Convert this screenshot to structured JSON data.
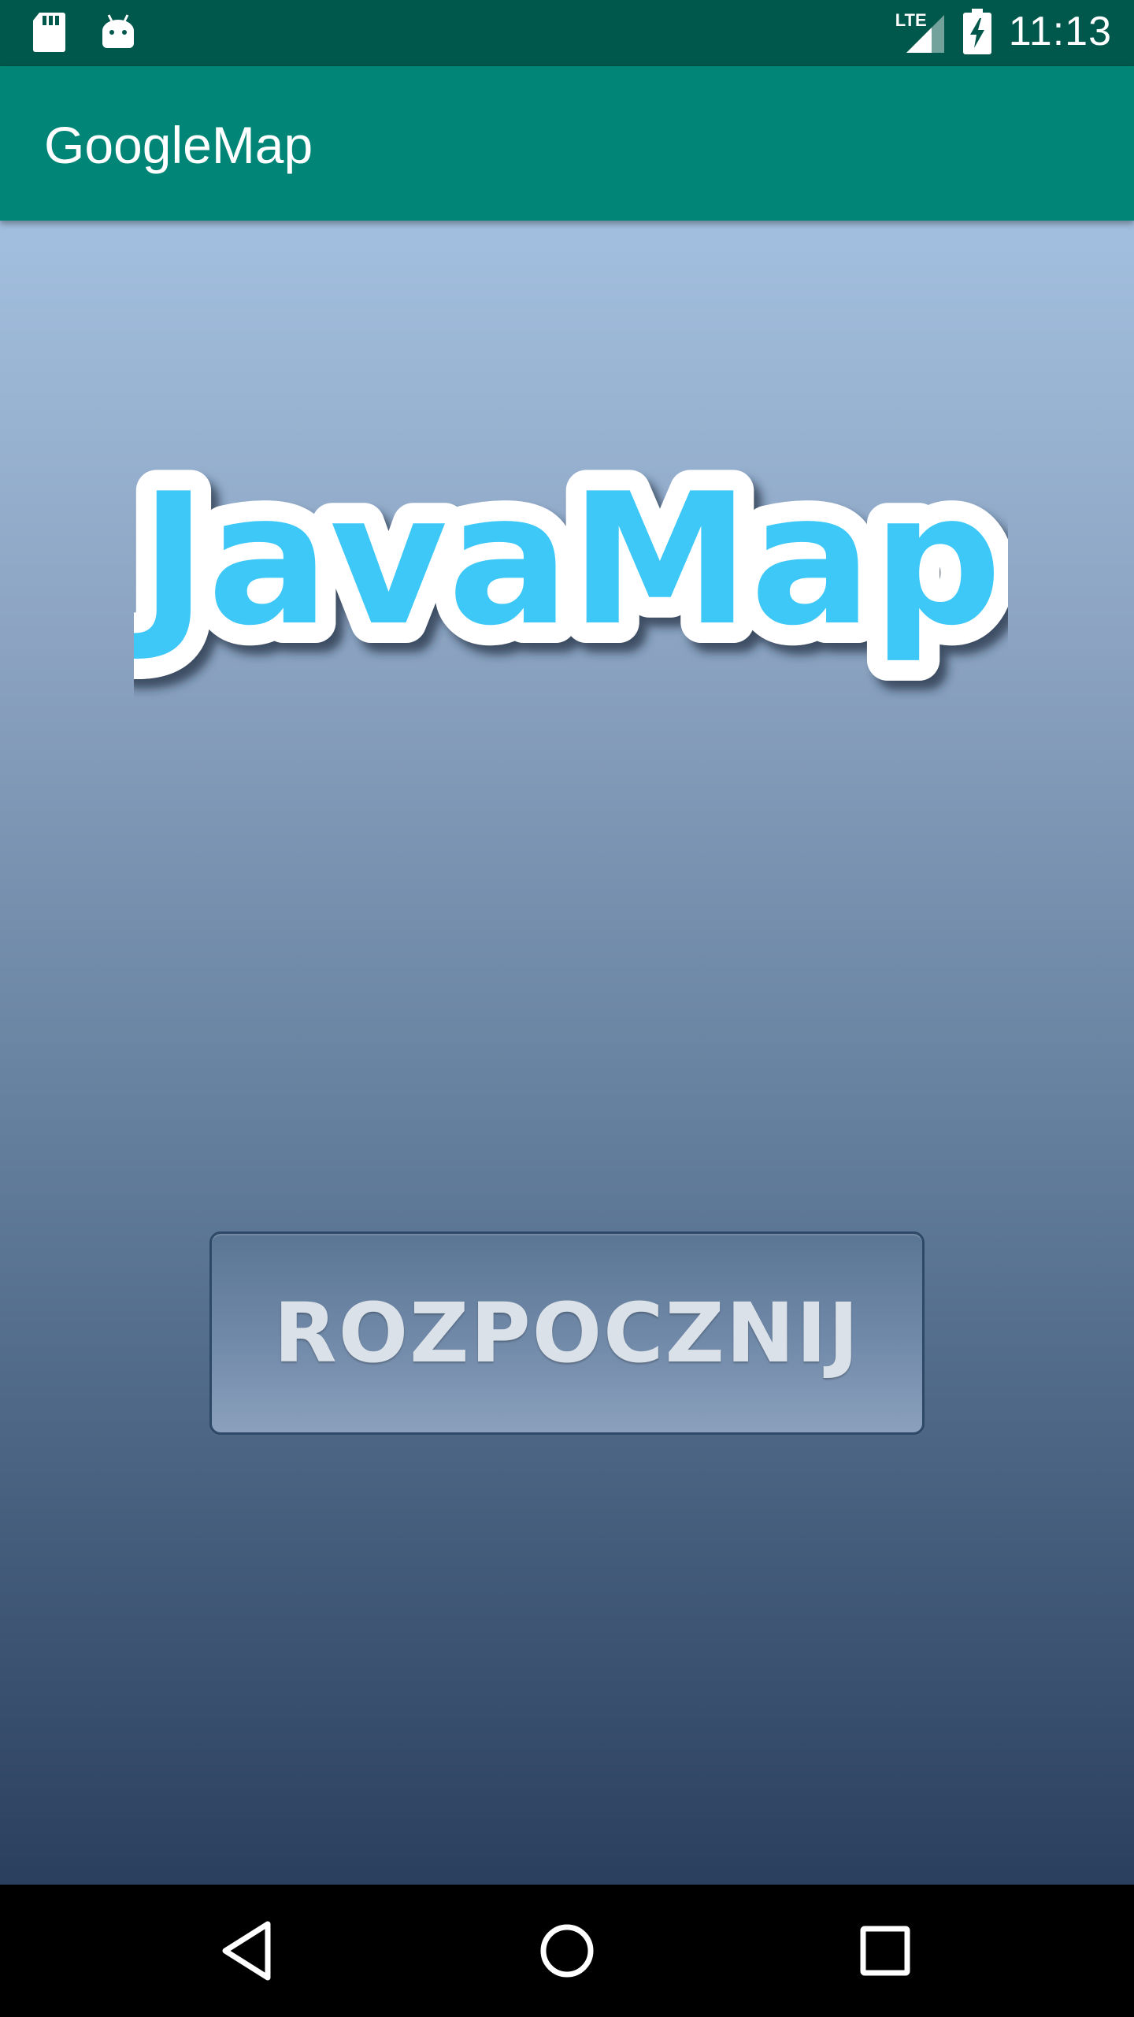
{
  "status_bar": {
    "time": "11:13",
    "network": "LTE",
    "icons": [
      "sd-card-icon",
      "android-icon",
      "signal-icon",
      "battery-charging-icon"
    ]
  },
  "app_bar": {
    "title": "GoogleMap"
  },
  "main": {
    "logo_text": "JavaMap",
    "start_button_label": "ROZPOCZNIJ"
  },
  "nav_bar": {
    "icons": [
      "back-icon",
      "home-icon",
      "recents-icon"
    ]
  },
  "colors": {
    "status_bar": "#00574b",
    "app_bar": "#008577",
    "logo_fill": "#3ec8f8",
    "logo_outline": "#ffffff"
  }
}
